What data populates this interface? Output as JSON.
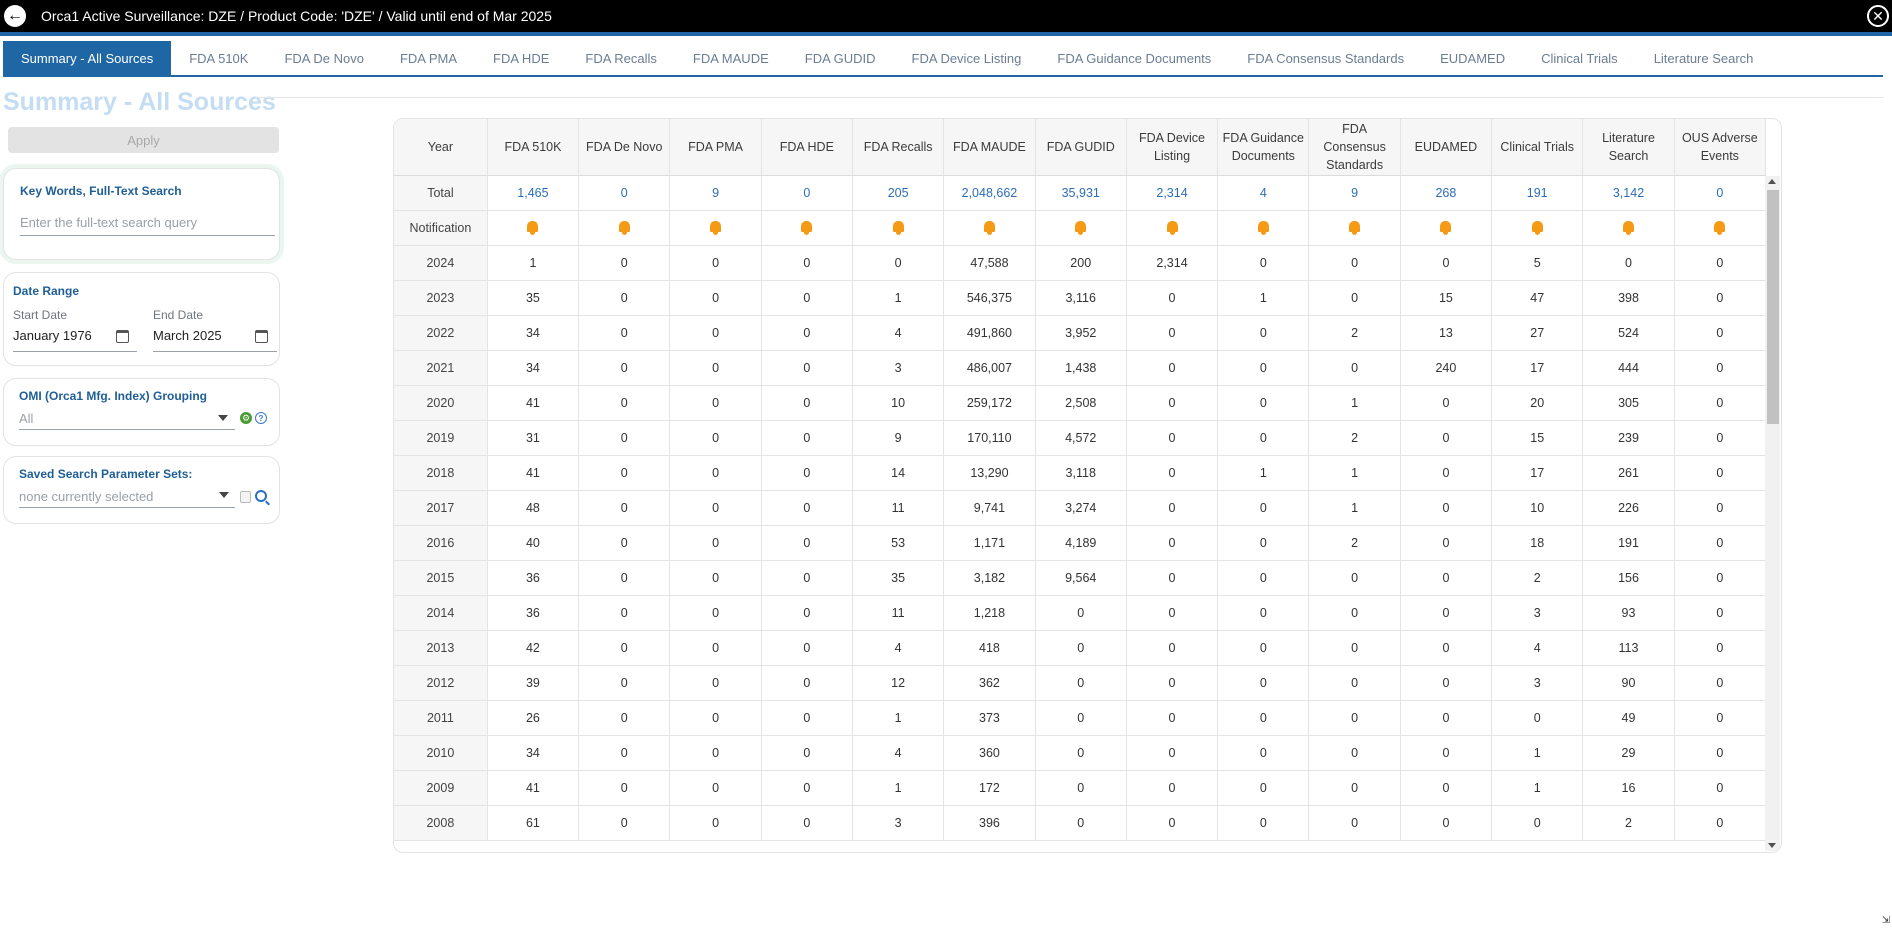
{
  "header": {
    "title": "Orca1 Active Surveillance: DZE / Product Code: 'DZE' / Valid until end of Mar 2025",
    "back_icon": "arrow-left-icon",
    "close_icon": "close-icon"
  },
  "tabs": [
    {
      "label": "Summary - All Sources",
      "active": true
    },
    {
      "label": "FDA 510K"
    },
    {
      "label": "FDA De Novo"
    },
    {
      "label": "FDA PMA"
    },
    {
      "label": "FDA HDE"
    },
    {
      "label": "FDA Recalls"
    },
    {
      "label": "FDA MAUDE"
    },
    {
      "label": "FDA GUDID"
    },
    {
      "label": "FDA Device Listing"
    },
    {
      "label": "FDA Guidance Documents"
    },
    {
      "label": "FDA Consensus Standards"
    },
    {
      "label": "EUDAMED"
    },
    {
      "label": "Clinical Trials"
    },
    {
      "label": "Literature Search"
    }
  ],
  "page_title": "Summary - All Sources",
  "sidebar": {
    "apply_label": "Apply",
    "search": {
      "label": "Key Words, Full-Text Search",
      "placeholder": "Enter the full-text search query"
    },
    "date_range": {
      "label": "Date Range",
      "start_label": "Start Date",
      "start_value": "January 1976",
      "end_label": "End Date",
      "end_value": "March 2025"
    },
    "omi": {
      "label": "OMI (Orca1 Mfg. Index) Grouping",
      "value": "All"
    },
    "saved": {
      "label": "Saved Search Parameter Sets:",
      "value": "none currently selected"
    }
  },
  "table": {
    "columns": [
      "Year",
      "FDA 510K",
      "FDA De Novo",
      "FDA PMA",
      "FDA HDE",
      "FDA Recalls",
      "FDA MAUDE",
      "FDA GUDID",
      "FDA Device Listing",
      "FDA Guidance Documents",
      "FDA Consensus Standards",
      "EUDAMED",
      "Clinical Trials",
      "Literature Search",
      "OUS Adverse Events"
    ],
    "total_row": [
      "Total",
      "1,465",
      "0",
      "9",
      "0",
      "205",
      "2,048,662",
      "35,931",
      "2,314",
      "4",
      "9",
      "268",
      "191",
      "3,142",
      "0"
    ],
    "notification_label": "Notification",
    "notification_icon": "bell-icon",
    "rows": [
      [
        "2024",
        "1",
        "0",
        "0",
        "0",
        "0",
        "47,588",
        "200",
        "2,314",
        "0",
        "0",
        "0",
        "5",
        "0",
        "0"
      ],
      [
        "2023",
        "35",
        "0",
        "0",
        "0",
        "1",
        "546,375",
        "3,116",
        "0",
        "1",
        "0",
        "15",
        "47",
        "398",
        "0"
      ],
      [
        "2022",
        "34",
        "0",
        "0",
        "0",
        "4",
        "491,860",
        "3,952",
        "0",
        "0",
        "2",
        "13",
        "27",
        "524",
        "0"
      ],
      [
        "2021",
        "34",
        "0",
        "0",
        "0",
        "3",
        "486,007",
        "1,438",
        "0",
        "0",
        "0",
        "240",
        "17",
        "444",
        "0"
      ],
      [
        "2020",
        "41",
        "0",
        "0",
        "0",
        "10",
        "259,172",
        "2,508",
        "0",
        "0",
        "1",
        "0",
        "20",
        "305",
        "0"
      ],
      [
        "2019",
        "31",
        "0",
        "0",
        "0",
        "9",
        "170,110",
        "4,572",
        "0",
        "0",
        "2",
        "0",
        "15",
        "239",
        "0"
      ],
      [
        "2018",
        "41",
        "0",
        "0",
        "0",
        "14",
        "13,290",
        "3,118",
        "0",
        "1",
        "1",
        "0",
        "17",
        "261",
        "0"
      ],
      [
        "2017",
        "48",
        "0",
        "0",
        "0",
        "11",
        "9,741",
        "3,274",
        "0",
        "0",
        "1",
        "0",
        "10",
        "226",
        "0"
      ],
      [
        "2016",
        "40",
        "0",
        "0",
        "0",
        "53",
        "1,171",
        "4,189",
        "0",
        "0",
        "2",
        "0",
        "18",
        "191",
        "0"
      ],
      [
        "2015",
        "36",
        "0",
        "0",
        "0",
        "35",
        "3,182",
        "9,564",
        "0",
        "0",
        "0",
        "0",
        "2",
        "156",
        "0"
      ],
      [
        "2014",
        "36",
        "0",
        "0",
        "0",
        "11",
        "1,218",
        "0",
        "0",
        "0",
        "0",
        "0",
        "3",
        "93",
        "0"
      ],
      [
        "2013",
        "42",
        "0",
        "0",
        "0",
        "4",
        "418",
        "0",
        "0",
        "0",
        "0",
        "0",
        "4",
        "113",
        "0"
      ],
      [
        "2012",
        "39",
        "0",
        "0",
        "0",
        "12",
        "362",
        "0",
        "0",
        "0",
        "0",
        "0",
        "3",
        "90",
        "0"
      ],
      [
        "2011",
        "26",
        "0",
        "0",
        "0",
        "1",
        "373",
        "0",
        "0",
        "0",
        "0",
        "0",
        "0",
        "49",
        "0"
      ],
      [
        "2010",
        "34",
        "0",
        "0",
        "0",
        "4",
        "360",
        "0",
        "0",
        "0",
        "0",
        "0",
        "1",
        "29",
        "0"
      ],
      [
        "2009",
        "41",
        "0",
        "0",
        "0",
        "1",
        "172",
        "0",
        "0",
        "0",
        "0",
        "0",
        "1",
        "16",
        "0"
      ],
      [
        "2008",
        "61",
        "0",
        "0",
        "0",
        "3",
        "396",
        "0",
        "0",
        "0",
        "0",
        "0",
        "0",
        "2",
        "0"
      ]
    ]
  },
  "colors": {
    "accent": "#1f66a5",
    "notification": "#f49a15",
    "link": "#2d6db8",
    "title_light": "#c4ddf2"
  }
}
